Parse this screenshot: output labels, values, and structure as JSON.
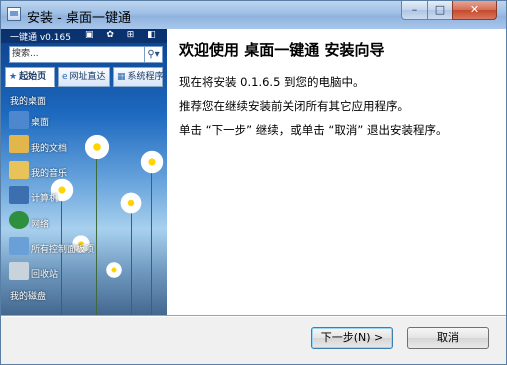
{
  "window": {
    "title": "安装 - 桌面一键通",
    "min_label": "–",
    "max_label": "□",
    "close_label": "✕"
  },
  "preview": {
    "app_title": "一键通 v0.165",
    "header_icons": "▣ ✿ ⊞ ◧ ─ ✕",
    "search_placeholder": "搜索...",
    "search_glyph": "⚲▾",
    "tabs": [
      {
        "icon": "★",
        "label": "起始页"
      },
      {
        "icon": "e",
        "label": "网址直达"
      },
      {
        "icon": "▦",
        "label": "系统程序"
      }
    ],
    "items": [
      {
        "label": "我的桌面",
        "has_icon": false
      },
      {
        "label": "桌面",
        "has_icon": true,
        "color": "#4d88cf"
      },
      {
        "label": "我的文档",
        "has_icon": true,
        "color": "#e2b64a"
      },
      {
        "label": "我的音乐",
        "has_icon": true,
        "color": "#e7c35a"
      },
      {
        "label": "计算机",
        "has_icon": true,
        "color": "#3c6fb0"
      },
      {
        "label": "网络",
        "has_icon": true,
        "color": "#2e8f3e"
      },
      {
        "label": "所有控制面板项",
        "has_icon": true,
        "color": "#6aa0d8"
      },
      {
        "label": "回收站",
        "has_icon": true,
        "color": "#c9d3dc"
      },
      {
        "label": "我的磁盘",
        "has_icon": false
      }
    ]
  },
  "wizard": {
    "heading": "欢迎使用 桌面一键通 安装向导",
    "line1": "现在将安装 0.1.6.5 到您的电脑中。",
    "line2": "推荐您在继续安装前关闭所有其它应用程序。",
    "line3": "单击 “下一步” 继续，或单击 “取消” 退出安装程序。"
  },
  "buttons": {
    "next": "下一步(N) >",
    "cancel": "取消"
  }
}
